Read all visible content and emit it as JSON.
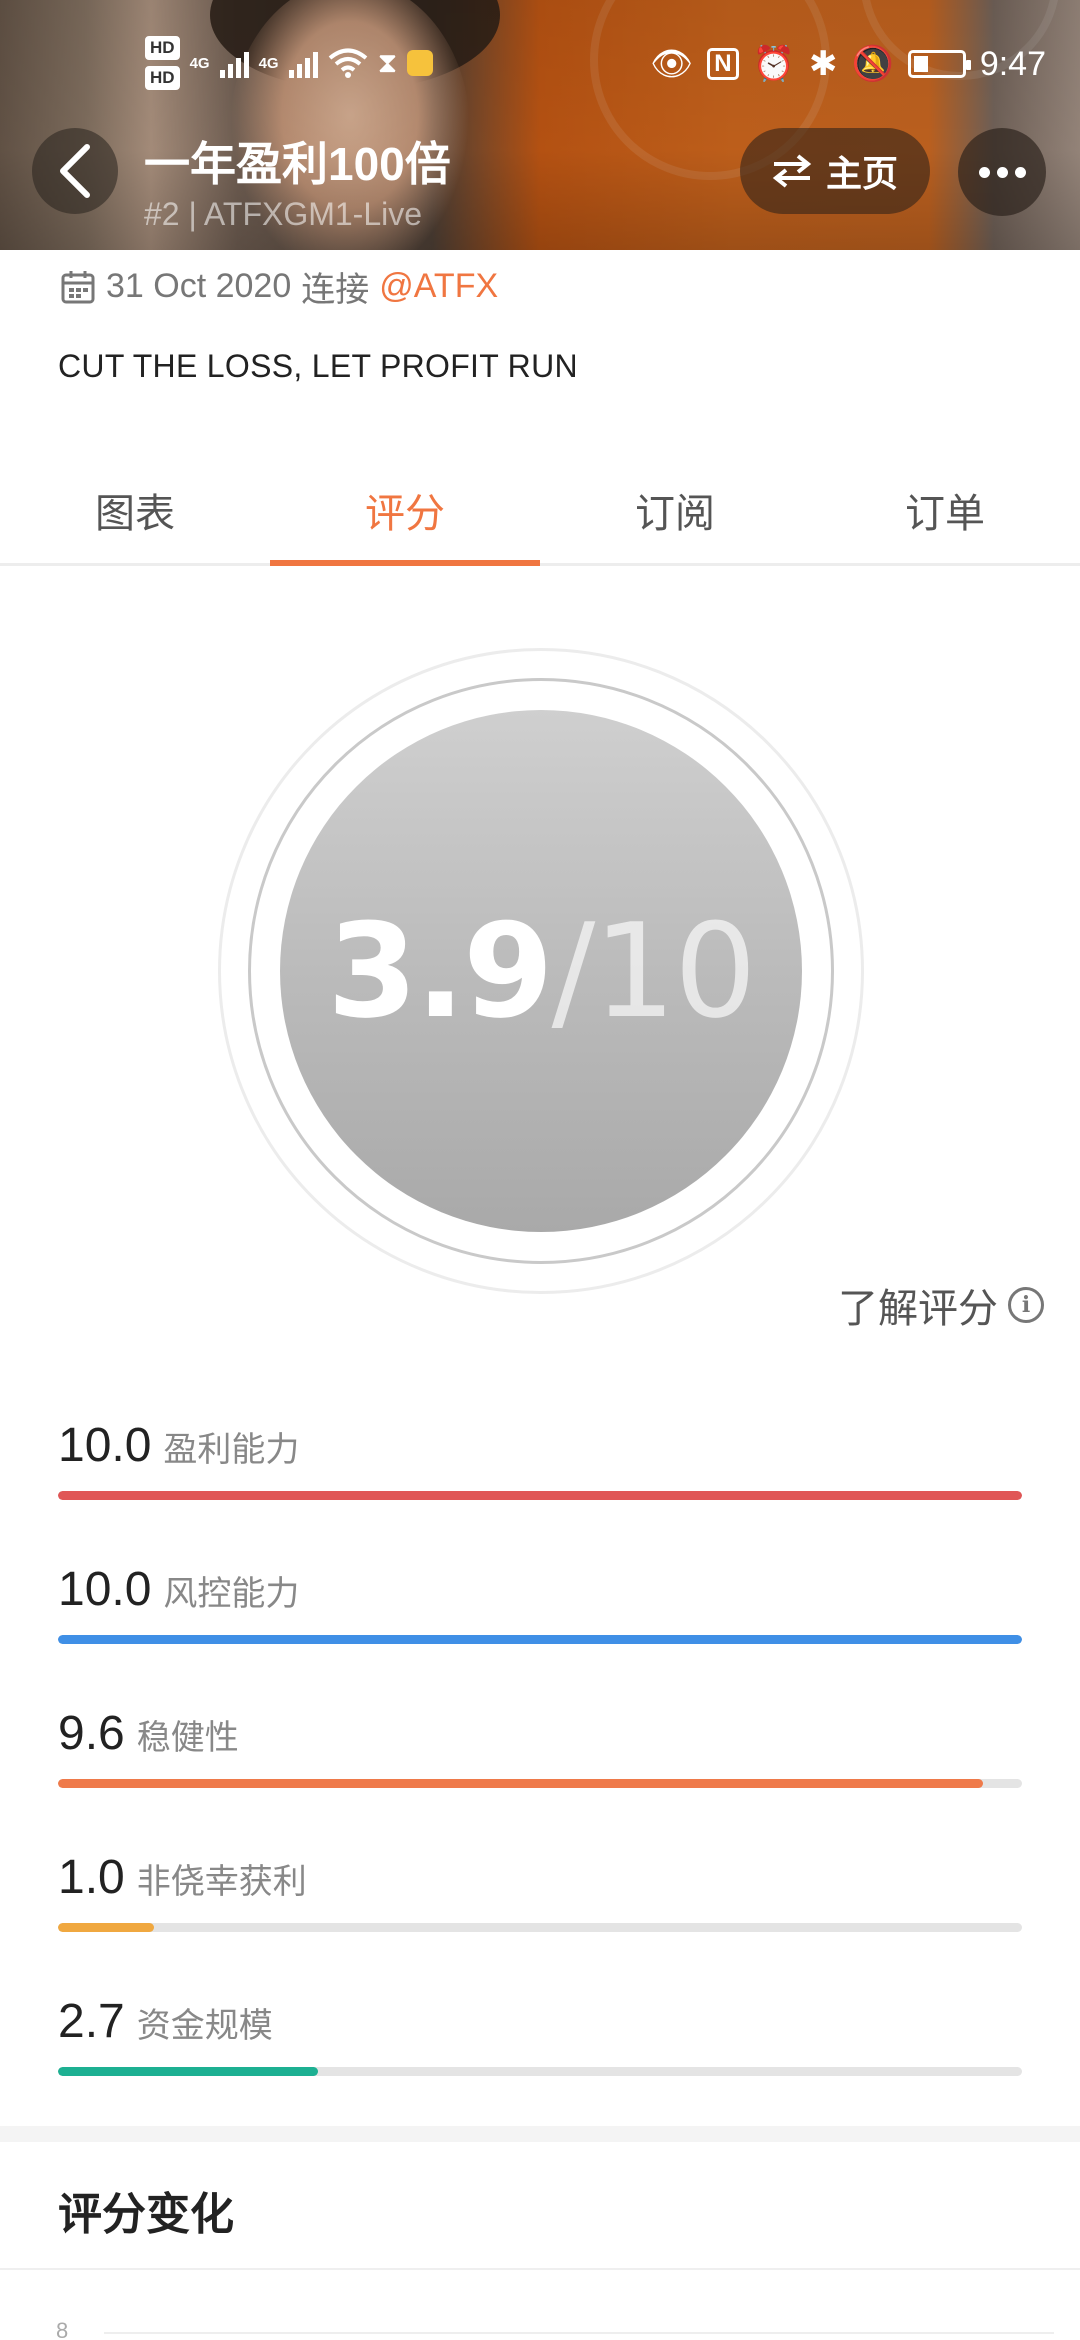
{
  "status_bar": {
    "hd1": "HD",
    "hd2": "HD",
    "net1": "4G",
    "net2": "4G",
    "time": "9:47",
    "icons": [
      "eye-icon",
      "nfc-icon",
      "alarm-icon",
      "bluetooth-icon",
      "bell-off-icon",
      "battery-icon"
    ],
    "battery_level": 0.2
  },
  "header": {
    "title": "一年盈利100倍",
    "subtitle": "#2 | ATFXGM1-Live",
    "home_label": "主页"
  },
  "info": {
    "date": "31 Oct 2020",
    "connect_word": "连接",
    "handle": "@ATFX",
    "motto": "CUT THE LOSS, LET PROFIT RUN"
  },
  "tabs": [
    {
      "label": "图表",
      "active": false
    },
    {
      "label": "评分",
      "active": true
    },
    {
      "label": "订阅",
      "active": false
    },
    {
      "label": "订单",
      "active": false
    }
  ],
  "score": {
    "value": "3.9",
    "denominator": "/10",
    "learn_label": "了解评分"
  },
  "metrics": [
    {
      "value": "10.0",
      "label": "盈利能力",
      "fraction": 1.0,
      "color": "#e05656"
    },
    {
      "value": "10.0",
      "label": "风控能力",
      "fraction": 1.0,
      "color": "#3f8fe6"
    },
    {
      "value": "9.6",
      "label": "稳健性",
      "fraction": 0.96,
      "color": "#ef7a4a"
    },
    {
      "value": "1.0",
      "label": "非侥幸获利",
      "fraction": 0.1,
      "color": "#f0a840"
    },
    {
      "value": "2.7",
      "label": "资金规模",
      "fraction": 0.27,
      "color": "#1db092"
    }
  ],
  "score_change": {
    "title": "评分变化",
    "axis_top": "8"
  },
  "colors": {
    "accent": "#f07641"
  }
}
